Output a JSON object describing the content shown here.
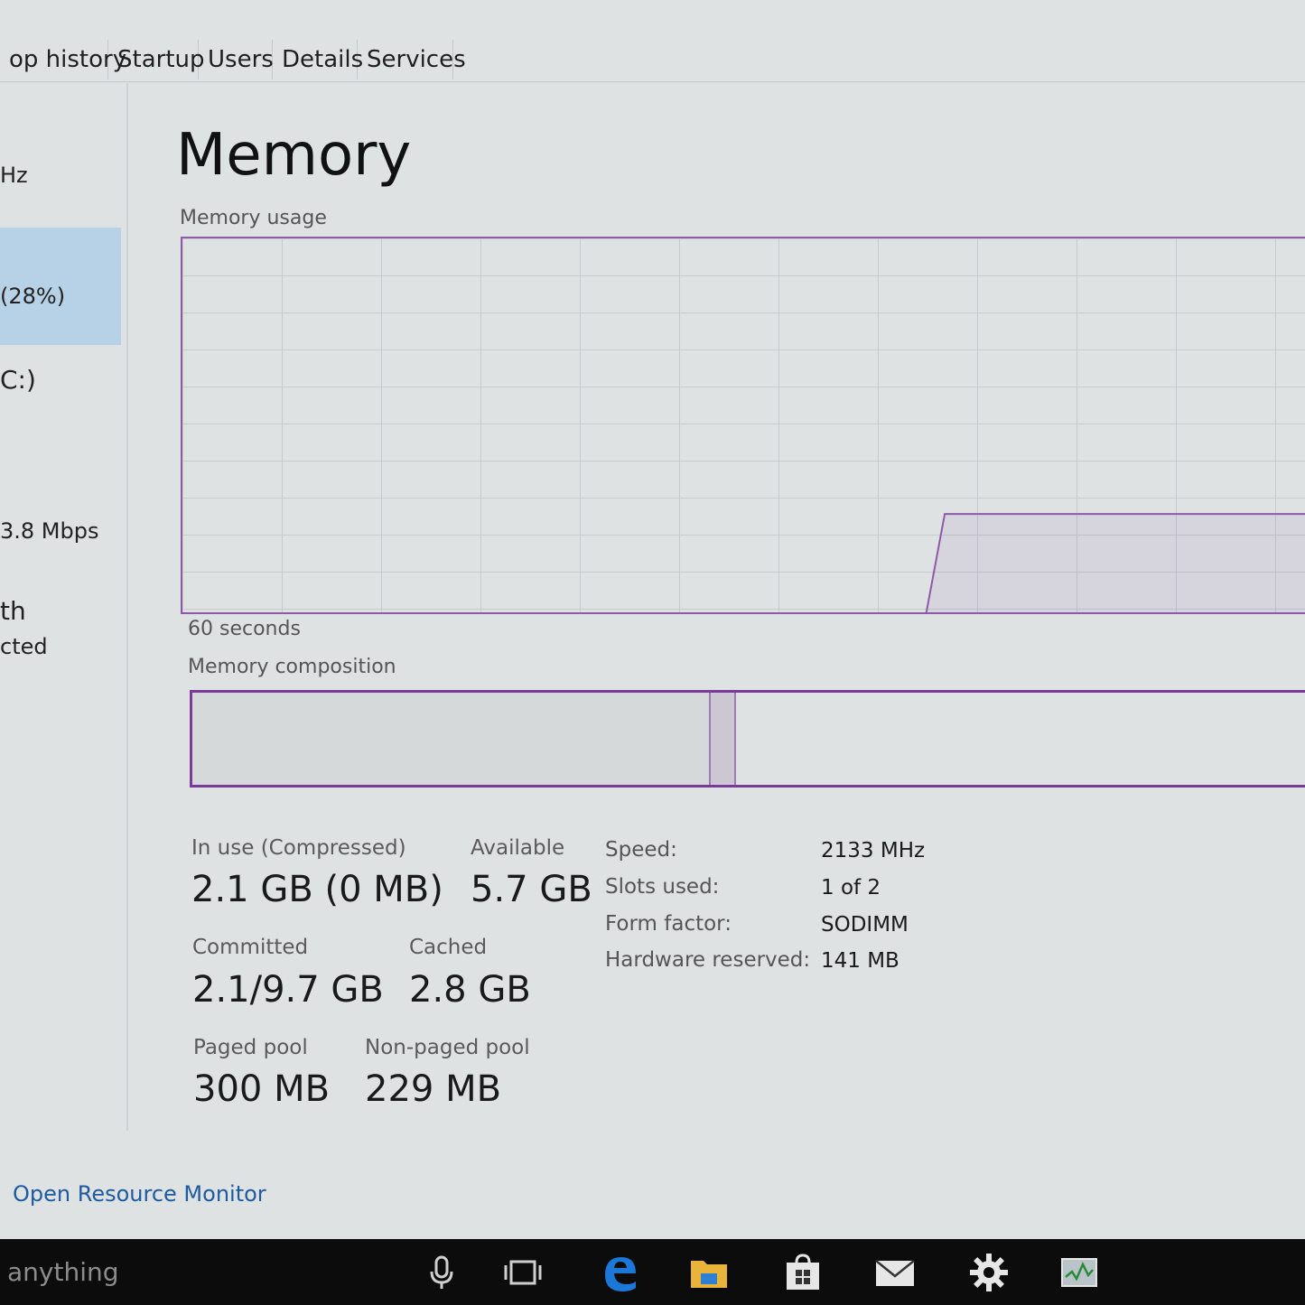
{
  "tabs": [
    {
      "label": "op history"
    },
    {
      "label": "Startup"
    },
    {
      "label": "Users"
    },
    {
      "label": "Details"
    },
    {
      "label": "Services"
    }
  ],
  "sidebar": {
    "items": [
      {
        "label": "Hz"
      },
      {
        "label": "(28%)"
      },
      {
        "label": "C:)"
      },
      {
        "label": "3.8 Mbps"
      },
      {
        "label": "th"
      },
      {
        "label": "cted"
      }
    ]
  },
  "memory": {
    "title": "Memory",
    "usage_label": "Memory usage",
    "time_label": "60 seconds",
    "composition_label": "Memory composition",
    "stats": {
      "in_use_label": "In use (Compressed)",
      "in_use_value": "2.1 GB (0 MB)",
      "available_label": "Available",
      "available_value": "5.7 GB",
      "committed_label": "Committed",
      "committed_value": "2.1/9.7 GB",
      "cached_label": "Cached",
      "cached_value": "2.8 GB",
      "paged_label": "Paged pool",
      "paged_value": "300 MB",
      "nonpaged_label": "Non-paged pool",
      "nonpaged_value": "229 MB"
    },
    "details": [
      {
        "key": "Speed:",
        "value": "2133 MHz"
      },
      {
        "key": "Slots used:",
        "value": "1 of 2"
      },
      {
        "key": "Form factor:",
        "value": "SODIMM"
      },
      {
        "key": "Hardware reserved:",
        "value": "141 MB"
      }
    ],
    "usage_history_percent": [
      0,
      0,
      0,
      0,
      0,
      0,
      0,
      0,
      0,
      0,
      0,
      0,
      0,
      0,
      0,
      0,
      0,
      0,
      0,
      0,
      0,
      0,
      0,
      0,
      0,
      0,
      0,
      0,
      0,
      0,
      0,
      0,
      0,
      0,
      0,
      0,
      0,
      0,
      0,
      0,
      27,
      27,
      27,
      27,
      27,
      27,
      27,
      27,
      27,
      27,
      27,
      27,
      27,
      27,
      27,
      27,
      27,
      27,
      27,
      27
    ],
    "composition_fraction": {
      "in_use": 0.466,
      "modified": 0.023,
      "standby_free": 0.511
    }
  },
  "link": {
    "label": "Open Resource Monitor"
  },
  "taskbar": {
    "search_text": "anything",
    "icons": [
      "microphone-icon",
      "task-view-icon",
      "edge-icon",
      "file-explorer-icon",
      "store-icon",
      "mail-icon",
      "settings-icon",
      "task-manager-icon"
    ]
  },
  "colors": {
    "accent": "#8e5aa8",
    "selected": "#b7d2e6",
    "link": "#1e5aa0"
  }
}
